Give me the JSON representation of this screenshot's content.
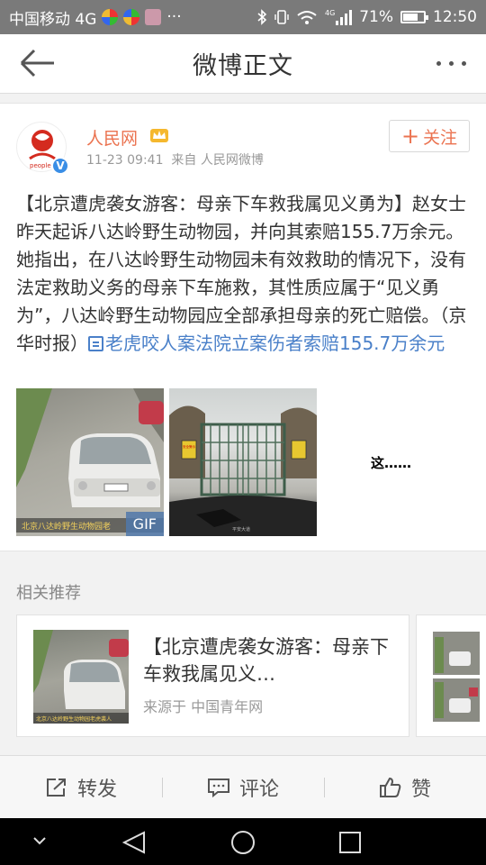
{
  "status_bar": {
    "carrier": "中国移动 4G",
    "more": "···",
    "network": "4G",
    "battery": "71%",
    "battery_level": 0.71,
    "time": "12:50"
  },
  "header": {
    "title": "微博正文"
  },
  "post": {
    "author": "人民网",
    "time": "11-23 09:41",
    "source": "来自 人民网微博",
    "follow_label": "关注",
    "text_before_link": "【北京遭虎袭女游客：母亲下车救我属见义勇为】赵女士昨天起诉八达岭野生动物园，并向其索赔155.7万余元。她指出，在八达岭野生动物园未有效救助的情况下，没有法定救助义务的母亲下车施救，其性质应属于“见义勇为”，八达岭野生动物园应全部承担母亲的死亡赔偿。（京华时报）",
    "link_text": "老虎咬人案法院立案伤者索赔155.7万余元",
    "images": [
      {
        "caption": "北京八达岭野生动物园老",
        "badge": "GIF"
      },
      {
        "sign": "安全警示",
        "watermark": "平安大道"
      },
      {
        "text": "这……"
      }
    ]
  },
  "related": {
    "title": "相关推荐",
    "cards": [
      {
        "title": "【北京遭虎袭女游客：母亲下车救我属见义…",
        "source": "来源于 中国青年网",
        "thumb_caption": "北京八达岭野生动物园老虎袭人"
      }
    ]
  },
  "actions": {
    "repost": "转发",
    "comment": "评论",
    "like": "赞"
  },
  "colors": {
    "accent": "#eb7350",
    "link": "#4a80c9",
    "status_bar": "#7a7a7a"
  }
}
